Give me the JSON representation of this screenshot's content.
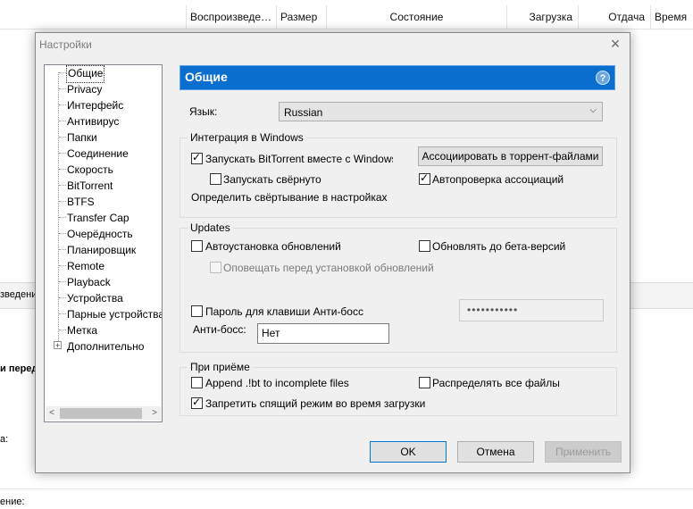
{
  "background": {
    "columns": [
      "Воспроизведе…",
      "Размер",
      "Состояние",
      "Загрузка",
      "Отдача",
      "Время"
    ],
    "tab_fragment": "зведени",
    "frag_bold": "и перед",
    "frag_a": "а:",
    "frag_b": "ение:"
  },
  "dialog": {
    "title": "Настройки",
    "close_glyph": "×",
    "tree": {
      "items": [
        "Общие",
        "Privacy",
        "Интерфейс",
        "Антивирус",
        "Папки",
        "Соединение",
        "Скорость",
        "BitTorrent",
        "BTFS",
        "Transfer Cap",
        "Очерёдность",
        "Планировщик",
        "Remote",
        "Playback",
        "Устройства",
        "Парные устройства",
        "Метка",
        "Дополнительно"
      ],
      "expander": "+",
      "scroll_left": "<",
      "scroll_right": ">"
    },
    "panel": {
      "title": "Общие",
      "help": "?",
      "language_label": "Язык:",
      "language_value": "Russian",
      "windows_group": {
        "title": "Интеграция в Windows",
        "start_with_windows": "Запускать BitTorrent вместе с Windows",
        "start_minimized": "Запускать свёрнуто",
        "minimize_note": "Определить свёртывание в настройках",
        "associate_button": "Ассоциировать в торрент-файлами",
        "auto_check_assoc": "Автопроверка ассоциаций"
      },
      "updates_group": {
        "title": "Updates",
        "auto_install": "Автоустановка обновлений",
        "beta_updates": "Обновлять до бета-версий",
        "notify_before": "Оповещать перед установкой обновлений"
      },
      "boss_key": {
        "password_label": "Пароль для клавиши Анти-босс",
        "password_mask": "•••••••••••",
        "key_label": "Анти-босс:",
        "key_value": "Нет"
      },
      "receive_group": {
        "title": "При приёме",
        "append_ext": "Append .!bt to incomplete files",
        "preallocate": "Распределять все файлы",
        "prevent_sleep": "Запретить спящий режим во время загрузки"
      }
    },
    "buttons": {
      "ok": "OK",
      "cancel": "Отмена",
      "apply": "Применить"
    }
  },
  "state": {
    "start_with_windows": true,
    "start_minimized": false,
    "auto_check_assoc": true,
    "auto_install": false,
    "beta_updates": false,
    "notify_before": false,
    "boss_password": false,
    "append_ext": false,
    "preallocate": false,
    "prevent_sleep": true
  },
  "colors": {
    "header_blue": "#0a6ecf",
    "dialog_bg": "#f0f0f0"
  }
}
